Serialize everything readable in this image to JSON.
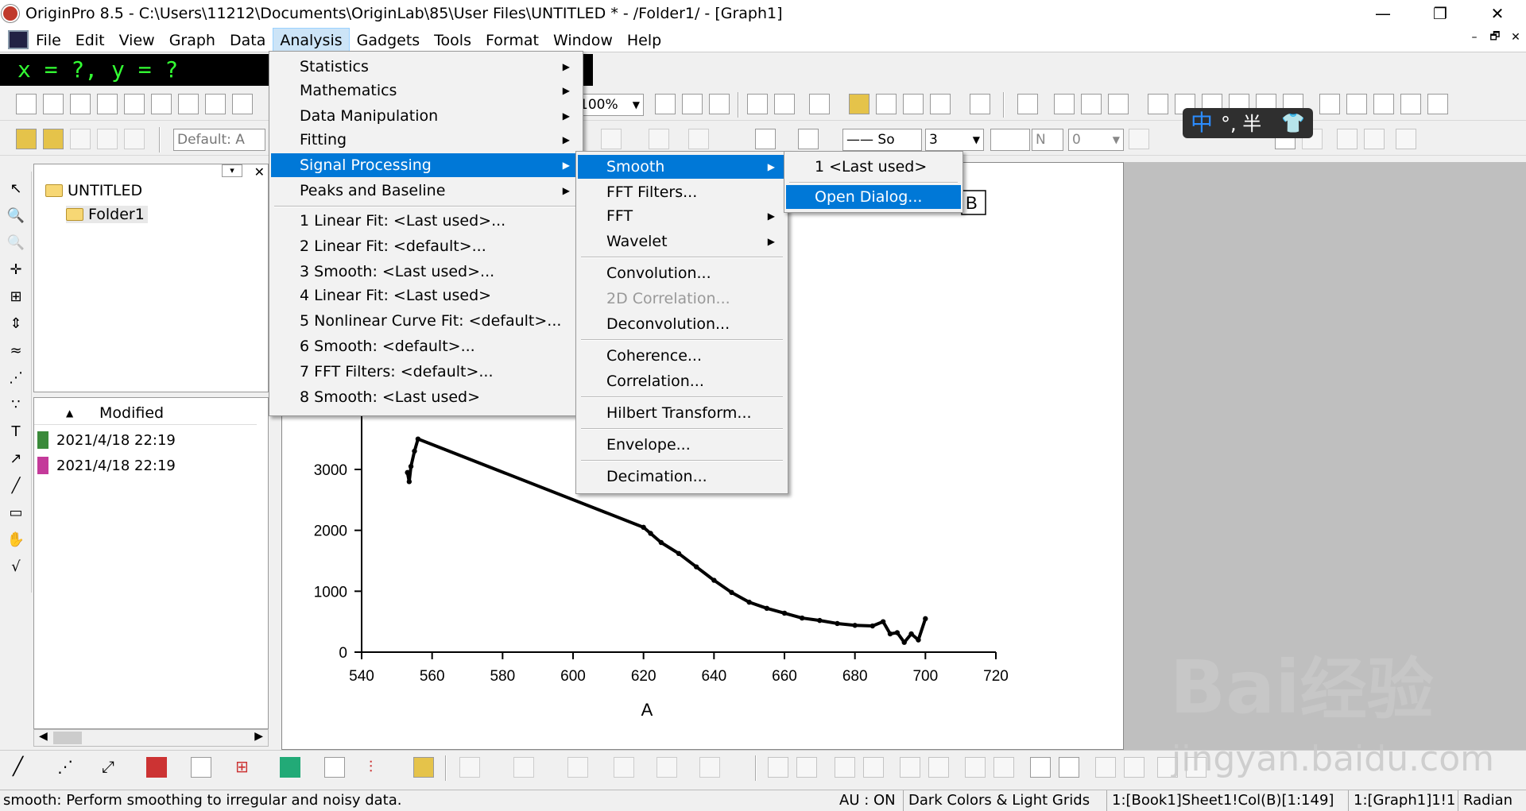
{
  "window": {
    "title": "OriginPro 8.5 - C:\\Users\\11212\\Documents\\OriginLab\\85\\User Files\\UNTITLED * - /Folder1/ - [Graph1]",
    "minimize": "—",
    "maximize": "❐",
    "close": "✕"
  },
  "menubar": {
    "items": [
      "File",
      "Edit",
      "View",
      "Graph",
      "Data",
      "Analysis",
      "Gadgets",
      "Tools",
      "Format",
      "Window",
      "Help"
    ],
    "active": "Analysis",
    "mdi": [
      "–",
      "🗗",
      "✕"
    ]
  },
  "coords": "x = ?, y = ?",
  "toolbar": {
    "zoom": "100%",
    "font": "Default: A",
    "line_style": "—— So",
    "line_width": "3",
    "fill": "N",
    "pattern": "0"
  },
  "ime": {
    "lang": "中",
    "rest": "°, 半"
  },
  "explorer": {
    "root": "UNTITLED",
    "folder": "Folder1",
    "column": "Modified",
    "files": [
      {
        "date": "2021/4/18 22:19",
        "type": "workbook"
      },
      {
        "date": "2021/4/18 22:19",
        "type": "graph"
      }
    ]
  },
  "analysis_menu": {
    "items": [
      {
        "label": "Statistics",
        "submenu": true
      },
      {
        "label": "Mathematics",
        "submenu": true
      },
      {
        "label": "Data Manipulation",
        "submenu": true
      },
      {
        "label": "Fitting",
        "submenu": true
      },
      {
        "label": "Signal Processing",
        "submenu": true,
        "highlight": true
      },
      {
        "label": "Peaks and Baseline",
        "submenu": true
      },
      {
        "label": "1 Linear Fit: <Last used>..."
      },
      {
        "label": "2 Linear Fit: <default>..."
      },
      {
        "label": "3 Smooth: <Last used>..."
      },
      {
        "label": "4 Linear Fit: <Last used>"
      },
      {
        "label": "5 Nonlinear Curve Fit: <default>..."
      },
      {
        "label": "6 Smooth: <default>..."
      },
      {
        "label": "7 FFT Filters: <default>..."
      },
      {
        "label": "8 Smooth: <Last used>"
      }
    ]
  },
  "signal_menu": {
    "items": [
      {
        "label": "Smooth",
        "submenu": true,
        "highlight": true
      },
      {
        "label": "FFT Filters..."
      },
      {
        "label": "FFT",
        "submenu": true
      },
      {
        "label": "Wavelet",
        "submenu": true
      },
      {
        "label": "Convolution..."
      },
      {
        "label": "2D Correlation...",
        "disabled": true
      },
      {
        "label": "Deconvolution..."
      },
      {
        "label": "Coherence..."
      },
      {
        "label": "Correlation..."
      },
      {
        "label": "Hilbert Transform..."
      },
      {
        "label": "Envelope..."
      },
      {
        "label": "Decimation..."
      }
    ]
  },
  "smooth_menu": {
    "items": [
      {
        "label": "1 <Last used>"
      },
      {
        "label": "Open Dialog...",
        "highlight": true
      }
    ]
  },
  "chart_data": {
    "type": "scatter",
    "xlabel": "A",
    "ylabel": "B",
    "legend": "B",
    "xlim": [
      540,
      720
    ],
    "ylim": [
      0,
      3000
    ],
    "xticks": [
      540,
      560,
      580,
      600,
      620,
      640,
      660,
      680,
      700,
      720
    ],
    "yticks": [
      0,
      1000,
      2000,
      3000
    ],
    "series": [
      {
        "name": "B",
        "x": [
          553,
          553.5,
          554,
          555,
          556,
          620,
          622,
          625,
          630,
          635,
          640,
          645,
          650,
          655,
          660,
          665,
          670,
          675,
          680,
          685,
          688,
          690,
          692,
          694,
          696,
          698,
          700
        ],
        "y": [
          2950,
          2800,
          3050,
          3300,
          3500,
          2050,
          1950,
          1800,
          1620,
          1400,
          1180,
          980,
          820,
          720,
          640,
          560,
          520,
          470,
          440,
          430,
          500,
          300,
          320,
          160,
          300,
          200,
          550
        ]
      }
    ]
  },
  "status": {
    "hint": "smooth: Perform smoothing to irregular and noisy data.",
    "au": "AU : ON",
    "theme": "Dark Colors & Light Grids",
    "book": "1:[Book1]Sheet1!Col(B)[1:149]",
    "graph": "1:[Graph1]1!1",
    "unit": "Radian"
  },
  "watermark": {
    "brand": "Bai",
    "zh": "经验",
    "url": "jingyan.baidu.com"
  }
}
